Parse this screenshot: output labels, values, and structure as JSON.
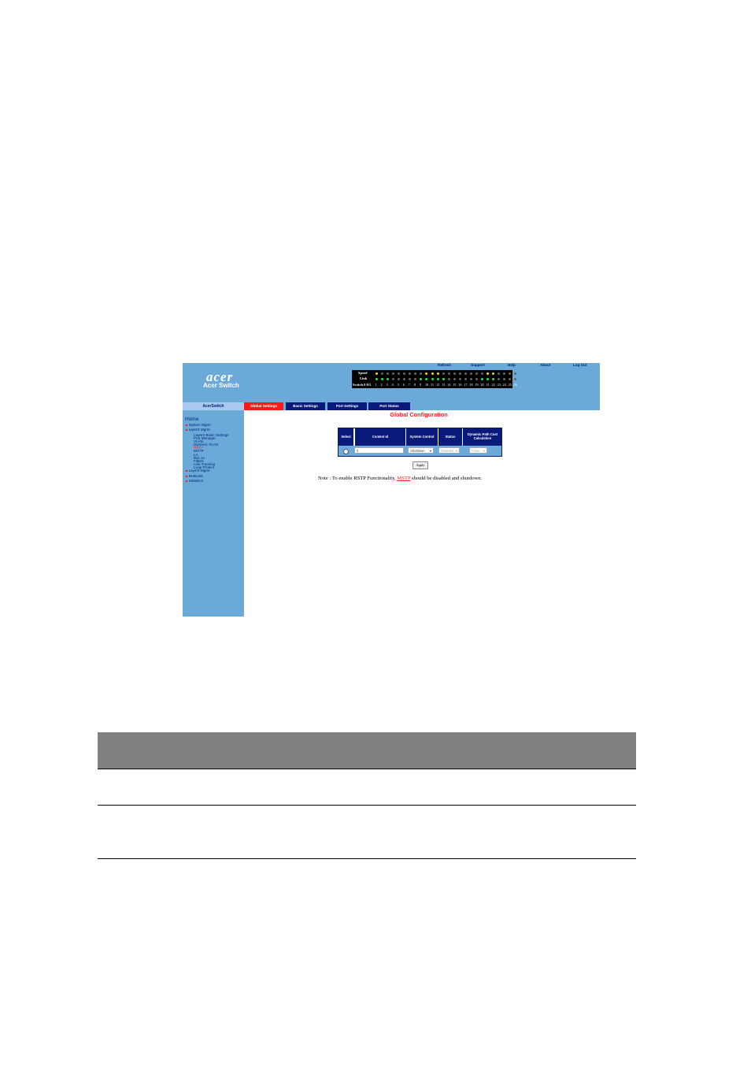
{
  "app": {
    "logo": "acer",
    "product": "Acer Switch"
  },
  "top_links": [
    "Refresh",
    "Support",
    "Help",
    "About",
    "Log Out"
  ],
  "panel": {
    "speed_label": "Speed",
    "link_label": "Link",
    "ports_label": "Switch 0 0/1",
    "port_numbers": [
      "1",
      "2",
      "3",
      "4",
      "5",
      "6",
      "7",
      "8",
      "9",
      "10",
      "11",
      "12",
      "13",
      "14",
      "15",
      "16",
      "17",
      "18",
      "19",
      "20",
      "21",
      "22",
      "23",
      "24",
      "25",
      "26"
    ],
    "led_colors": {
      "yellow": "#ffd21a",
      "green": "#29e82f",
      "off": "#5a6a5a"
    }
  },
  "sidebar": {
    "header": "AcerSwitch",
    "home": "Home",
    "items": [
      {
        "label": "System Mgmt",
        "bullet": true,
        "level": 0
      },
      {
        "label": "Layer2 Mgmt",
        "bullet": true,
        "level": 0
      },
      {
        "label": "Layer2 Basic Settings",
        "bullet": false,
        "level": 1
      },
      {
        "label": "Port Manager",
        "bullet": false,
        "level": 1
      },
      {
        "label": "VLAN",
        "bullet": false,
        "level": 1
      },
      {
        "label": "Dynamic VLAN",
        "bullet": false,
        "level": 1
      },
      {
        "label": "RSTP",
        "bullet": false,
        "level": 1,
        "active": true
      },
      {
        "label": "MSTP",
        "bullet": false,
        "level": 1
      },
      {
        "label": "LA",
        "bullet": false,
        "level": 1
      },
      {
        "label": "802.1x",
        "bullet": false,
        "level": 1
      },
      {
        "label": "Filters",
        "bullet": false,
        "level": 1
      },
      {
        "label": "Link Tracking",
        "bullet": false,
        "level": 1
      },
      {
        "label": "Loop Protect",
        "bullet": false,
        "level": 1
      },
      {
        "label": "Layer3 Mgmt",
        "bullet": true,
        "level": 0
      },
      {
        "label": "Multicast",
        "bullet": true,
        "level": 0
      },
      {
        "label": "Statistics",
        "bullet": true,
        "level": 0
      }
    ]
  },
  "tabs": [
    "Global Settings",
    "Basic Settings",
    "Port Settings",
    "Port Status"
  ],
  "page_title": "Global Configuration",
  "config_table": {
    "headers": [
      "Select",
      "Context Id",
      "System Control",
      "Status",
      "Dynamic Path Cost Calculation"
    ],
    "row": {
      "context_id": "0",
      "system_control": "Shutdown",
      "status": "Disabled",
      "dynamic_path_cost": "False"
    }
  },
  "apply_label": "Apply",
  "note": {
    "prefix": "Note : To enable RSTP Functionality, ",
    "link": "MSTP",
    "suffix": " should be disabled and shutdown."
  },
  "accent_colors": {
    "header_blue": "#0a1a7a",
    "active_red": "#ff1a1a",
    "light_blue": "#6aa9d8"
  }
}
